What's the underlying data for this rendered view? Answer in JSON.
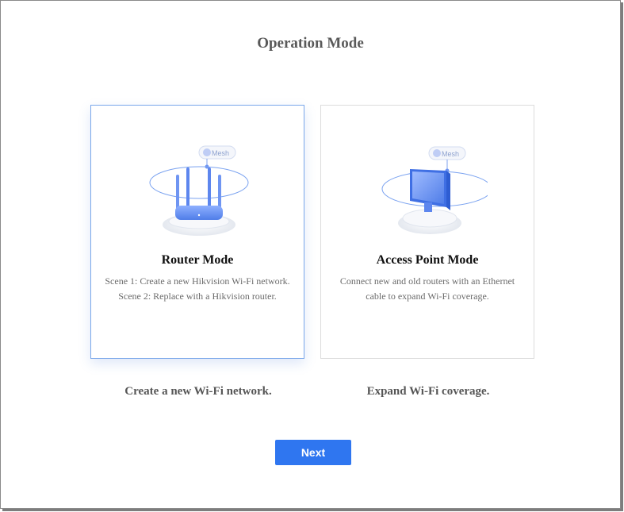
{
  "page": {
    "title": "Operation Mode"
  },
  "modes": [
    {
      "title": "Router Mode",
      "desc_lines": [
        "Scene 1: Create a new Hikvision Wi-Fi network.",
        "Scene 2: Replace with a Hikvision router."
      ],
      "caption": "Create a new Wi-Fi network.",
      "badge": "Mesh",
      "selected": true
    },
    {
      "title": "Access Point Mode",
      "desc_lines": [
        "Connect new and old routers with an Ethernet",
        "cable to expand Wi-Fi coverage."
      ],
      "caption": "Expand Wi-Fi coverage.",
      "badge": "Mesh",
      "selected": false
    }
  ],
  "actions": {
    "next_label": "Next"
  },
  "colors": {
    "accent": "#2f76f0",
    "selected_border": "#7aa7ea",
    "illustration_blue": "#6f95f2"
  }
}
